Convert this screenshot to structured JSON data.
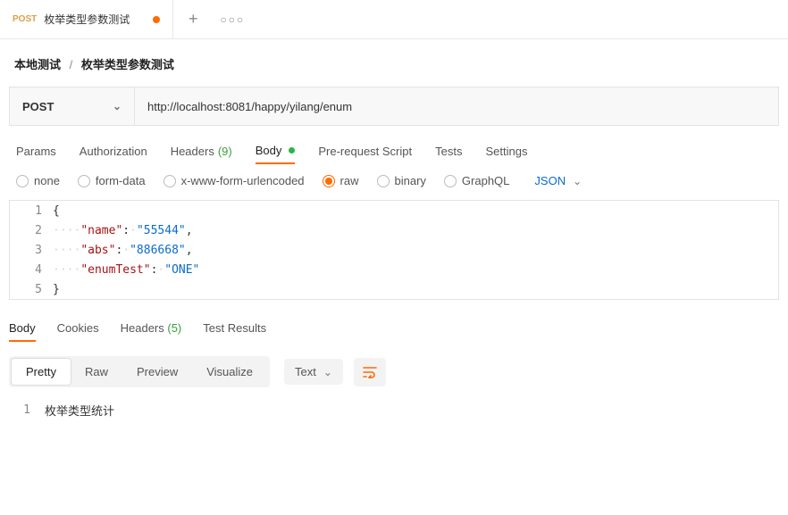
{
  "tab": {
    "method": "POST",
    "title": "枚举类型参数测试"
  },
  "breadcrumb": {
    "root": "本地测试",
    "current": "枚举类型参数测试"
  },
  "request": {
    "method": "POST",
    "url": "http://localhost:8081/happy/yilang/enum"
  },
  "subtabs": {
    "params": "Params",
    "authorization": "Authorization",
    "headers": "Headers",
    "headers_count": "(9)",
    "body": "Body",
    "prerequest": "Pre-request Script",
    "tests": "Tests",
    "settings": "Settings"
  },
  "bodytypes": {
    "none": "none",
    "form_data": "form-data",
    "x_www": "x-www-form-urlencoded",
    "raw": "raw",
    "binary": "binary",
    "graphql": "GraphQL",
    "lang": "JSON"
  },
  "editor": {
    "lines": [
      {
        "n": "1",
        "raw": "{"
      },
      {
        "n": "2",
        "key": "\"name\"",
        "val": "\"55544\"",
        "comma": ","
      },
      {
        "n": "3",
        "key": "\"abs\"",
        "val": "\"886668\"",
        "comma": ","
      },
      {
        "n": "4",
        "key": "\"enumTest\"",
        "val": "\"ONE\"",
        "comma": ""
      },
      {
        "n": "5",
        "raw": "}"
      }
    ]
  },
  "response": {
    "tabs": {
      "body": "Body",
      "cookies": "Cookies",
      "headers": "Headers",
      "headers_count": "(5)",
      "test_results": "Test Results"
    },
    "views": {
      "pretty": "Pretty",
      "raw": "Raw",
      "preview": "Preview",
      "visualize": "Visualize"
    },
    "format": "Text",
    "body": [
      {
        "n": "1",
        "text": "枚举类型统计"
      }
    ]
  }
}
